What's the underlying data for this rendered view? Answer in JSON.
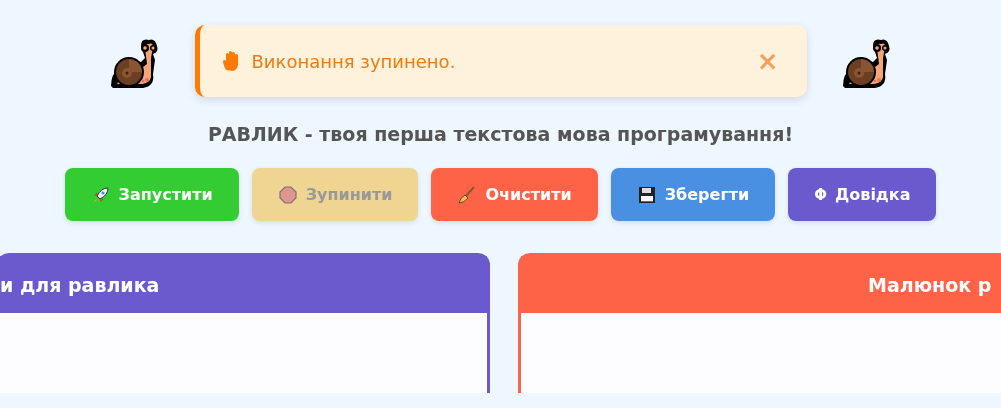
{
  "alert": {
    "message": "Виконання зупинено.",
    "close": "×"
  },
  "subtitle": "РАВЛИК - твоя перша текстова мова програмування!",
  "buttons": [
    {
      "kind": "rocket",
      "label": "Запустити",
      "color": "#33cc33",
      "disabled": false
    },
    {
      "kind": "stop",
      "label": "Зупинити",
      "color": "#f0d592",
      "disabled": true
    },
    {
      "kind": "broom",
      "label": "Очистити",
      "color": "#ff6347",
      "disabled": false
    },
    {
      "kind": "floppy",
      "label": "Зберегти",
      "color": "#4a90e2",
      "disabled": false
    },
    {
      "kind": "glyph",
      "glyph": "Φ",
      "label": "Довідка",
      "color": "#6a5acd",
      "disabled": false
    }
  ],
  "panels": [
    {
      "title": "и для равлика",
      "color": "#6a5acd"
    },
    {
      "title": "Малюнок р",
      "color": "#ff6347"
    }
  ]
}
